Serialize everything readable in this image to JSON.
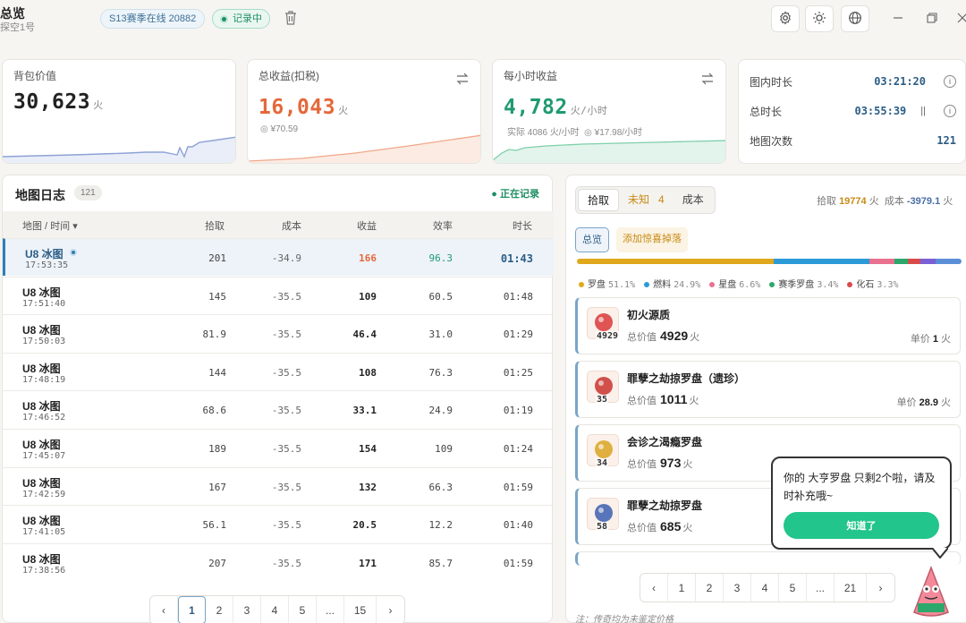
{
  "header": {
    "title": "总览",
    "subtitle": "探空1号",
    "season": "S13赛季在线 20882",
    "recording": "记录中"
  },
  "stats": {
    "bag": {
      "label": "背包价值",
      "value": "30,623",
      "unit": "火"
    },
    "income": {
      "label": "总收益(扣税)",
      "value": "16,043",
      "unit": "火",
      "sub": "¥70.59"
    },
    "hourly": {
      "label": "每小时收益",
      "value": "4,782",
      "unit": "火/小时",
      "real": "实际 4086 火/小时",
      "rmb": "¥17.98/小时"
    },
    "time": {
      "in_map_label": "图内时长",
      "in_map": "03:21:20",
      "total_label": "总时长",
      "total": "03:55:39",
      "maps_label": "地图次数",
      "maps": "121"
    }
  },
  "log": {
    "title": "地图日志",
    "count": "121",
    "live": "● 正在记录",
    "headers": [
      "地图 / 时间 ▾",
      "拾取",
      "成本",
      "收益",
      "效率",
      "时长"
    ],
    "rows": [
      {
        "map": "U8 冰图",
        "time": "17:53:35",
        "pick": "201",
        "cost": "-34.9",
        "profit": "166",
        "eff": "96.3",
        "dur": "01:43"
      },
      {
        "map": "U8 冰图",
        "time": "17:51:40",
        "pick": "145",
        "cost": "-35.5",
        "profit": "109",
        "eff": "60.5",
        "dur": "01:48"
      },
      {
        "map": "U8 冰图",
        "time": "17:50:03",
        "pick": "81.9",
        "cost": "-35.5",
        "profit": "46.4",
        "eff": "31.0",
        "dur": "01:29"
      },
      {
        "map": "U8 冰图",
        "time": "17:48:19",
        "pick": "144",
        "cost": "-35.5",
        "profit": "108",
        "eff": "76.3",
        "dur": "01:25"
      },
      {
        "map": "U8 冰图",
        "time": "17:46:52",
        "pick": "68.6",
        "cost": "-35.5",
        "profit": "33.1",
        "eff": "24.9",
        "dur": "01:19"
      },
      {
        "map": "U8 冰图",
        "time": "17:45:07",
        "pick": "189",
        "cost": "-35.5",
        "profit": "154",
        "eff": "109",
        "dur": "01:24"
      },
      {
        "map": "U8 冰图",
        "time": "17:42:59",
        "pick": "167",
        "cost": "-35.5",
        "profit": "132",
        "eff": "66.3",
        "dur": "01:59"
      },
      {
        "map": "U8 冰图",
        "time": "17:41:05",
        "pick": "56.1",
        "cost": "-35.5",
        "profit": "20.5",
        "eff": "12.2",
        "dur": "01:40"
      },
      {
        "map": "U8 冰图",
        "time": "17:38:56",
        "pick": "207",
        "cost": "-35.5",
        "profit": "171",
        "eff": "85.7",
        "dur": "01:59"
      }
    ],
    "pages": [
      "1",
      "2",
      "3",
      "4",
      "5",
      "...",
      "15"
    ]
  },
  "drops": {
    "tabs": [
      "拾取",
      "未知",
      "4",
      "成本"
    ],
    "summary_pick_label": "拾取",
    "summary_pick": "19774",
    "summary_unit": "火",
    "summary_cost_label": "成本",
    "summary_cost": "-3979.1",
    "seg_overview": "总览",
    "seg_add": "添加惊喜掉落",
    "legend": [
      {
        "name": "罗盘",
        "pct": "51.1%",
        "color": "#e0a81c"
      },
      {
        "name": "燃料",
        "pct": "24.9%",
        "color": "#2b9ad6"
      },
      {
        "name": "星盘",
        "pct": "6.6%",
        "color": "#e8718f"
      },
      {
        "name": "赛季罗盘",
        "pct": "3.4%",
        "color": "#2ba86b"
      },
      {
        "name": "化石",
        "pct": "3.3%",
        "color": "#d84a4a"
      }
    ],
    "bar": [
      {
        "frac": 0.511,
        "color": "#e0a81c"
      },
      {
        "frac": 0.249,
        "color": "#2b9ad6"
      },
      {
        "frac": 0.066,
        "color": "#e8718f"
      },
      {
        "frac": 0.034,
        "color": "#2ba86b"
      },
      {
        "frac": 0.033,
        "color": "#d84a4a"
      },
      {
        "frac": 0.04,
        "color": "#7b5fd6"
      },
      {
        "frac": 0.067,
        "color": "#5a8fd8"
      }
    ],
    "items": [
      {
        "name": "初火源质",
        "count": "4929",
        "total_label": "总价值",
        "total": "4929",
        "unit": "火",
        "price_label": "单价",
        "price": "1"
      },
      {
        "name": "罪孽之劫掠罗盘（遗珍）",
        "count": "35",
        "total_label": "总价值",
        "total": "1011",
        "unit": "火",
        "price_label": "单价",
        "price": "28.9"
      },
      {
        "name": "会诊之渴瘾罗盘",
        "count": "34",
        "total_label": "总价值",
        "total": "973",
        "unit": "火"
      },
      {
        "name": "罪孽之劫掠罗盘",
        "count": "58",
        "total_label": "总价值",
        "total": "685",
        "unit": "火"
      }
    ],
    "pages": [
      "1",
      "2",
      "3",
      "4",
      "5",
      "...",
      "21"
    ],
    "footnote": "注：传奇均为未鉴定价格"
  },
  "popup": {
    "text": "你的 大亨罗盘 只剩2个啦，请及时补充哦~",
    "button": "知道了"
  }
}
